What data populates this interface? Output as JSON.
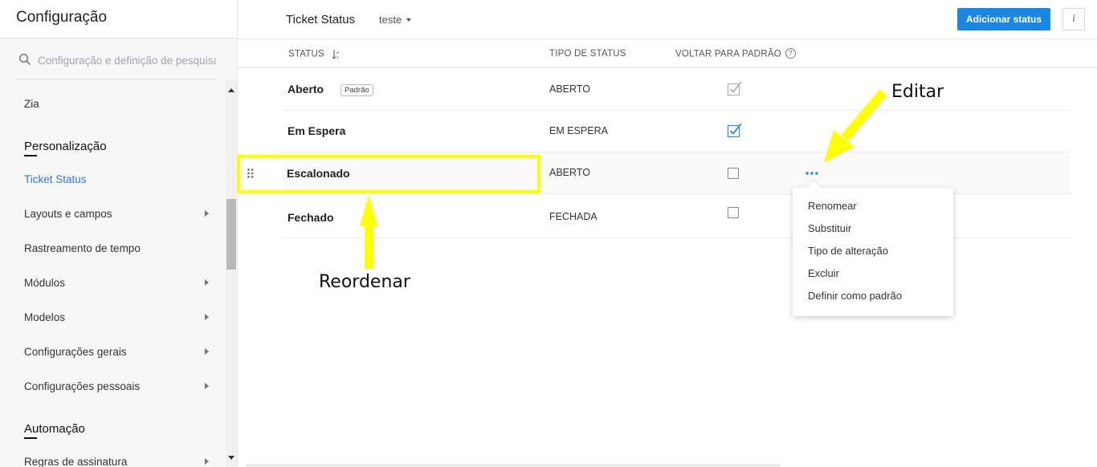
{
  "sidebar": {
    "title": "Configuração",
    "search_placeholder": "Configuração e definição de pesquisa",
    "top_item": "Zia",
    "section_personalizacao": "Personalização",
    "items": [
      {
        "label": "Ticket Status",
        "active": true,
        "has_submenu": false
      },
      {
        "label": "Layouts e campos",
        "active": false,
        "has_submenu": true
      },
      {
        "label": "Rastreamento de tempo",
        "active": false,
        "has_submenu": false
      },
      {
        "label": "Módulos",
        "active": false,
        "has_submenu": true
      },
      {
        "label": "Modelos",
        "active": false,
        "has_submenu": true
      },
      {
        "label": "Configurações gerais",
        "active": false,
        "has_submenu": true
      },
      {
        "label": "Configurações pessoais",
        "active": false,
        "has_submenu": true
      }
    ],
    "section_automacao": "Automação",
    "automacao_items": [
      {
        "label": "Regras de assinatura",
        "has_submenu": true
      }
    ]
  },
  "header": {
    "title": "Ticket Status",
    "department": "teste",
    "add_button": "Adicionar status",
    "info_button": "i"
  },
  "table": {
    "columns": {
      "status": "STATUS",
      "status_type": "TIPO DE STATUS",
      "revert_default": "VOLTAR PARA PADRÃO",
      "help": "?"
    },
    "rows": [
      {
        "name": "Aberto",
        "badge": "Padrão",
        "type": "ABERTO",
        "revert": true,
        "revert_disabled": true
      },
      {
        "name": "Em Espera",
        "badge": "",
        "type": "EM ESPERA",
        "revert": true,
        "revert_disabled": false
      },
      {
        "name": "Escalonado",
        "badge": "",
        "type": "ABERTO",
        "revert": false,
        "revert_disabled": false
      },
      {
        "name": "Fechado",
        "badge": "",
        "type": "FECHADA",
        "revert": false,
        "revert_disabled": false
      }
    ]
  },
  "menu": {
    "items": [
      "Renomear",
      "Substituir",
      "Tipo de alteração",
      "Excluir",
      "Definir como padrão"
    ]
  },
  "annotations": {
    "edit_label": "Editar",
    "reorder_label": "Reordenar",
    "color": "#ffff00"
  },
  "colors": {
    "accent": "#1c86e3",
    "active_link": "#2f7bd6",
    "highlight": "#ffff00"
  }
}
